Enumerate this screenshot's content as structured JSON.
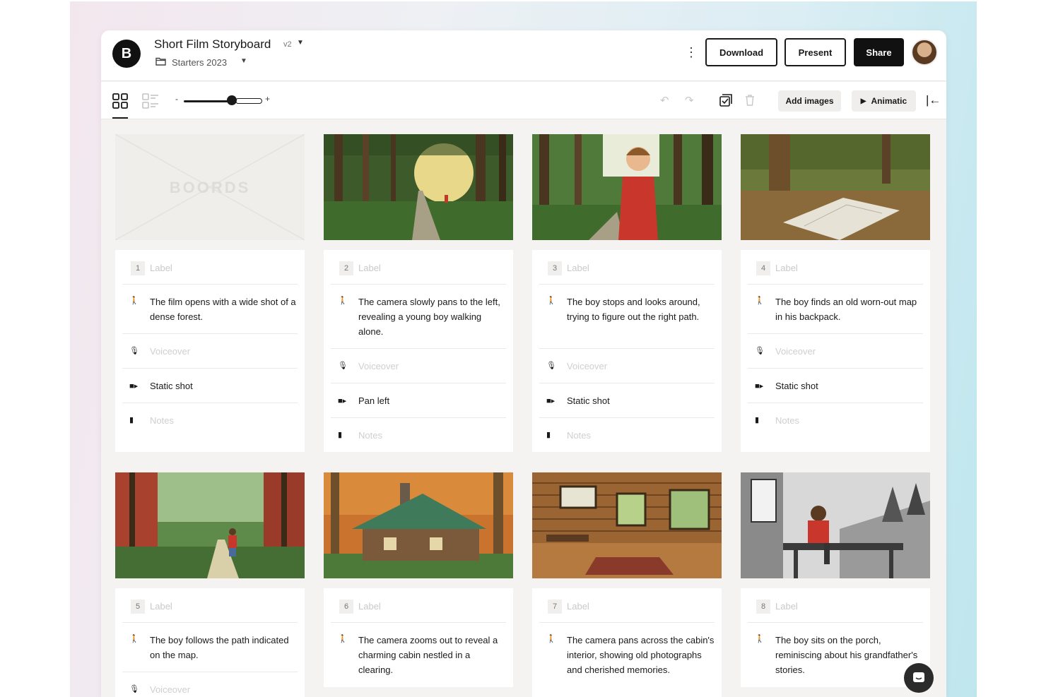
{
  "app": {
    "logo_letter": "B",
    "title": "Short Film Storyboard",
    "version": "v2",
    "project": "Starters 2023"
  },
  "header": {
    "download_label": "Download",
    "present_label": "Present",
    "share_label": "Share"
  },
  "toolbar": {
    "zoom_minus": "-",
    "zoom_plus": "+",
    "add_images_label": "Add images",
    "animatic_label": "Animatic"
  },
  "placeholder_watermark": "BOORDS",
  "frames": [
    {
      "number": "1",
      "label": "Label",
      "action": "The film opens with a wide shot of a dense forest.",
      "voiceover": "Voiceover",
      "camera": "Static shot",
      "notes": "Notes"
    },
    {
      "number": "2",
      "label": "Label",
      "action": "The camera slowly pans to the left, revealing a young boy walking alone.",
      "voiceover": "Voiceover",
      "camera": "Pan left",
      "notes": "Notes"
    },
    {
      "number": "3",
      "label": "Label",
      "action": "The boy stops and looks around, trying to figure out the right path.",
      "voiceover": "Voiceover",
      "camera": "Static shot",
      "notes": "Notes"
    },
    {
      "number": "4",
      "label": "Label",
      "action": "The boy finds an old worn-out map in his backpack.",
      "voiceover": "Voiceover",
      "camera": "Static shot",
      "notes": "Notes"
    },
    {
      "number": "5",
      "label": "Label",
      "action": "The boy follows the path indicated on the map.",
      "voiceover": "Voiceover"
    },
    {
      "number": "6",
      "label": "Label",
      "action": "The camera zooms out to reveal a charming cabin nestled in a clearing."
    },
    {
      "number": "7",
      "label": "Label",
      "action": "The camera pans across the cabin's interior, showing old photographs and cherished memories."
    },
    {
      "number": "8",
      "label": "Label",
      "action": "The boy sits on the porch, reminiscing about his grandfather's stories."
    }
  ]
}
